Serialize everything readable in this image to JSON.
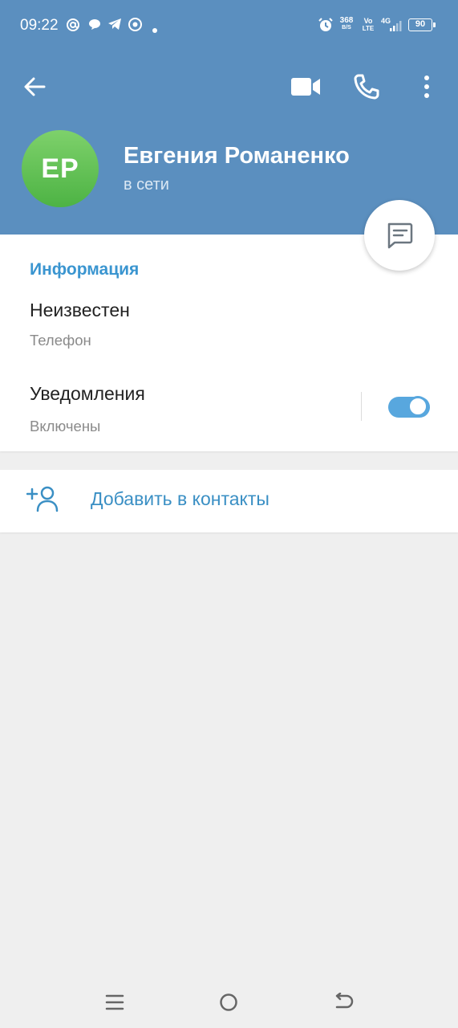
{
  "status_bar": {
    "time": "09:22",
    "net_speed_value": "368",
    "net_speed_unit": "B/S",
    "volte_top": "Vo",
    "volte_bottom": "LTE",
    "network": "4G",
    "battery": "90"
  },
  "toolbar": {
    "back_icon": "arrow-left-icon",
    "video_call_icon": "video-camera-icon",
    "call_icon": "phone-icon",
    "menu_icon": "more-vertical-icon"
  },
  "profile": {
    "initials": "ЕР",
    "name": "Евгения Романенко",
    "status": "в сети"
  },
  "fab": {
    "icon": "message-icon"
  },
  "info_section": {
    "title": "Информация",
    "phone_value": "Неизвестен",
    "phone_label": "Телефон",
    "notifications_title": "Уведомления",
    "notifications_status": "Включены",
    "notifications_enabled": true
  },
  "add_contact": {
    "icon": "add-user-icon",
    "label": "Добавить в контакты"
  },
  "nav_bar": {
    "menu_icon": "menu-icon",
    "home_icon": "home-circle-icon",
    "back_icon": "back-icon"
  },
  "colors": {
    "header": "#5b8fbf",
    "accent": "#3a95d0",
    "avatar": "#5fbf4f",
    "background": "#efefef"
  }
}
